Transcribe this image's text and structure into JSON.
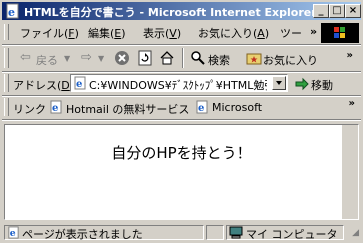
{
  "window": {
    "title": "HTMLを自分で書こう - Microsoft Internet Explorer",
    "controls": [
      "_",
      "□",
      "×"
    ]
  },
  "menu": {
    "items": [
      {
        "label": "ファイル(",
        "key": "F",
        "end": ")"
      },
      {
        "label": "編集(",
        "key": "E",
        "end": ")"
      },
      {
        "label": "表示(",
        "key": "V",
        "end": ")"
      },
      {
        "label": "お気に入り(",
        "key": "A",
        "end": ")"
      },
      {
        "label": "ツー",
        "key": "",
        "end": ""
      }
    ],
    "chevron": "»"
  },
  "toolbar": {
    "back": "戻る",
    "search": "検索",
    "favorites": "お気に入り"
  },
  "address": {
    "label": "アドレス(",
    "label_key": "D",
    "label_end": ")",
    "value": "C:¥WINDOWS¥ﾃﾞｽｸﾄｯﾌﾟ¥HTML勉強",
    "go": "移動"
  },
  "links": {
    "label": "リンク",
    "items": [
      "Hotmail の無料サービス",
      "Microsoft"
    ],
    "chevron": "»"
  },
  "content": {
    "heading": "自分のHPを持とう！"
  },
  "status": {
    "text": "ページが表示されました",
    "zone": "マイ コンピュータ"
  }
}
